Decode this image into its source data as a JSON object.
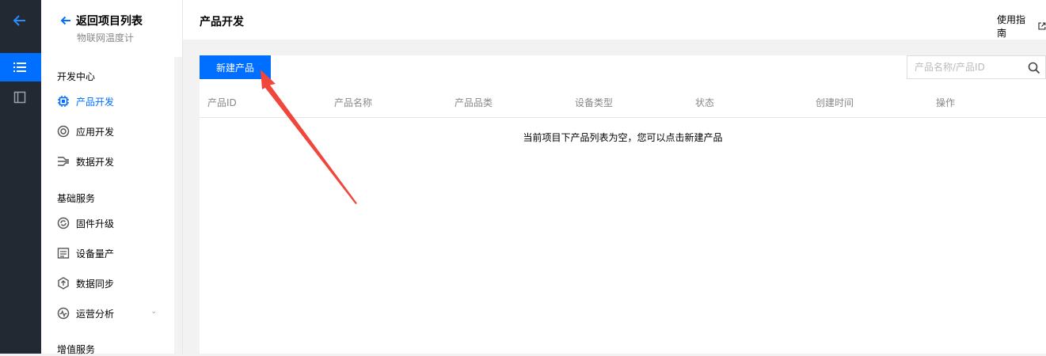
{
  "nav_rail": {
    "back_icon": "arrow-left-icon",
    "list_icon": "list-icon",
    "book_icon": "book-icon"
  },
  "sidebar": {
    "back_label": "返回项目列表",
    "project_name": "物联网温度计",
    "groups": [
      {
        "label": "开发中心",
        "items": [
          {
            "label": "产品开发",
            "icon": "chip-icon",
            "active": true
          },
          {
            "label": "应用开发",
            "icon": "target-icon"
          },
          {
            "label": "数据开发",
            "icon": "data-flow-icon"
          }
        ]
      },
      {
        "label": "基础服务",
        "items": [
          {
            "label": "固件升级",
            "icon": "refresh-icon"
          },
          {
            "label": "设备量产",
            "icon": "document-list-icon"
          },
          {
            "label": "数据同步",
            "icon": "sync-icon"
          },
          {
            "label": "运营分析",
            "icon": "pulse-icon",
            "expandable": true
          }
        ]
      },
      {
        "label": "增值服务"
      }
    ]
  },
  "header": {
    "title": "产品开发",
    "guide_label": "使用指南"
  },
  "toolbar": {
    "new_product_label": "新建产品",
    "search_placeholder": "产品名称/产品ID"
  },
  "table": {
    "columns": [
      "产品ID",
      "产品名称",
      "产品品类",
      "设备类型",
      "状态",
      "创建时间",
      "操作"
    ],
    "empty_text": "当前项目下产品列表为空，您可以点击新建产品"
  },
  "colors": {
    "accent": "#006eff",
    "rail_bg": "#222932",
    "annotation_arrow": "#f0463c"
  }
}
